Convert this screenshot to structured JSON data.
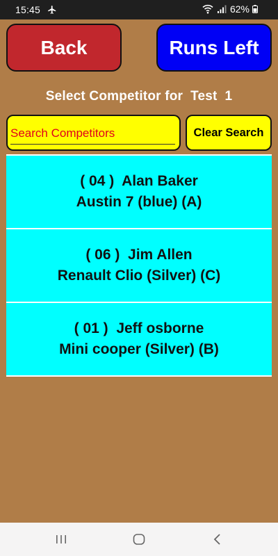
{
  "status_bar": {
    "time": "15:45",
    "battery": "62%"
  },
  "header": {
    "back_label": "Back",
    "runs_left_label": "Runs Left"
  },
  "title": "Select Competitor for  Test  1",
  "search": {
    "placeholder": "Search Competitors",
    "value": "",
    "clear_label": "Clear Search"
  },
  "competitors": [
    {
      "line1": "( 04 )  Alan Baker",
      "line2": "Austin 7 (blue) (A)"
    },
    {
      "line1": "( 06 )  Jim Allen",
      "line2": "Renault Clio (Silver) (C)"
    },
    {
      "line1": "( 01 )  Jeff osborne",
      "line2": "Mini cooper (Silver) (B)"
    }
  ],
  "colors": {
    "background": "#b07d48",
    "back_button": "#c1272d",
    "runs_left_button": "#0000f5",
    "search_yellow": "#ffff00",
    "search_text": "#e0001b",
    "list_cyan": "#00ffff"
  },
  "icons": {
    "airplane": "airplane-icon",
    "wifi": "wifi-icon",
    "signal": "signal-icon",
    "battery": "battery-icon",
    "recents": "recents-icon",
    "home": "home-icon",
    "back": "back-icon"
  }
}
